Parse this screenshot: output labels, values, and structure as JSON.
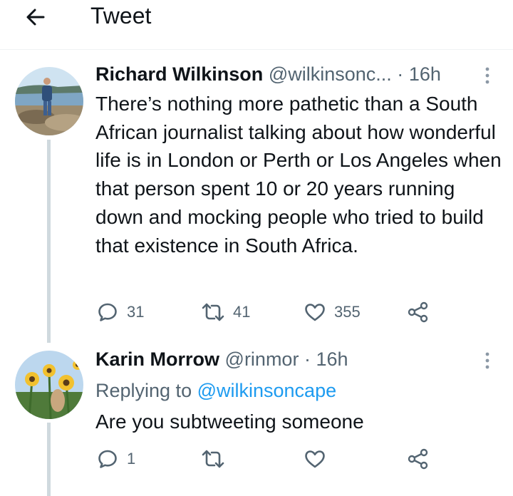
{
  "header": {
    "title": "Tweet",
    "back_icon": "arrow-left-icon"
  },
  "colors": {
    "text": "#0f1419",
    "secondary": "#536471",
    "accent": "#1d9bf0",
    "thread_line": "#cfd9de"
  },
  "main_tweet": {
    "name": "Richard Wilkinson",
    "handle": "@wilkinsonc...",
    "separator": "·",
    "time": "16h",
    "text": "There’s nothing more pathetic than a South African journalist talking about how wonderful life is in London or Perth or Los Angeles when that person spent 10 or 20 years running down and mocking people who tried to build that existence in South Africa.",
    "actions": {
      "replies": "31",
      "retweets": "41",
      "likes": "355"
    }
  },
  "reply_tweet": {
    "name": "Karin Morrow",
    "handle": "@rinmor",
    "separator": "·",
    "time": "16h",
    "replying_prefix": "Replying to",
    "replying_to": "@wilkinsoncape",
    "text": "Are you subtweeting someone",
    "actions": {
      "replies": "1",
      "retweets": "",
      "likes": ""
    }
  }
}
